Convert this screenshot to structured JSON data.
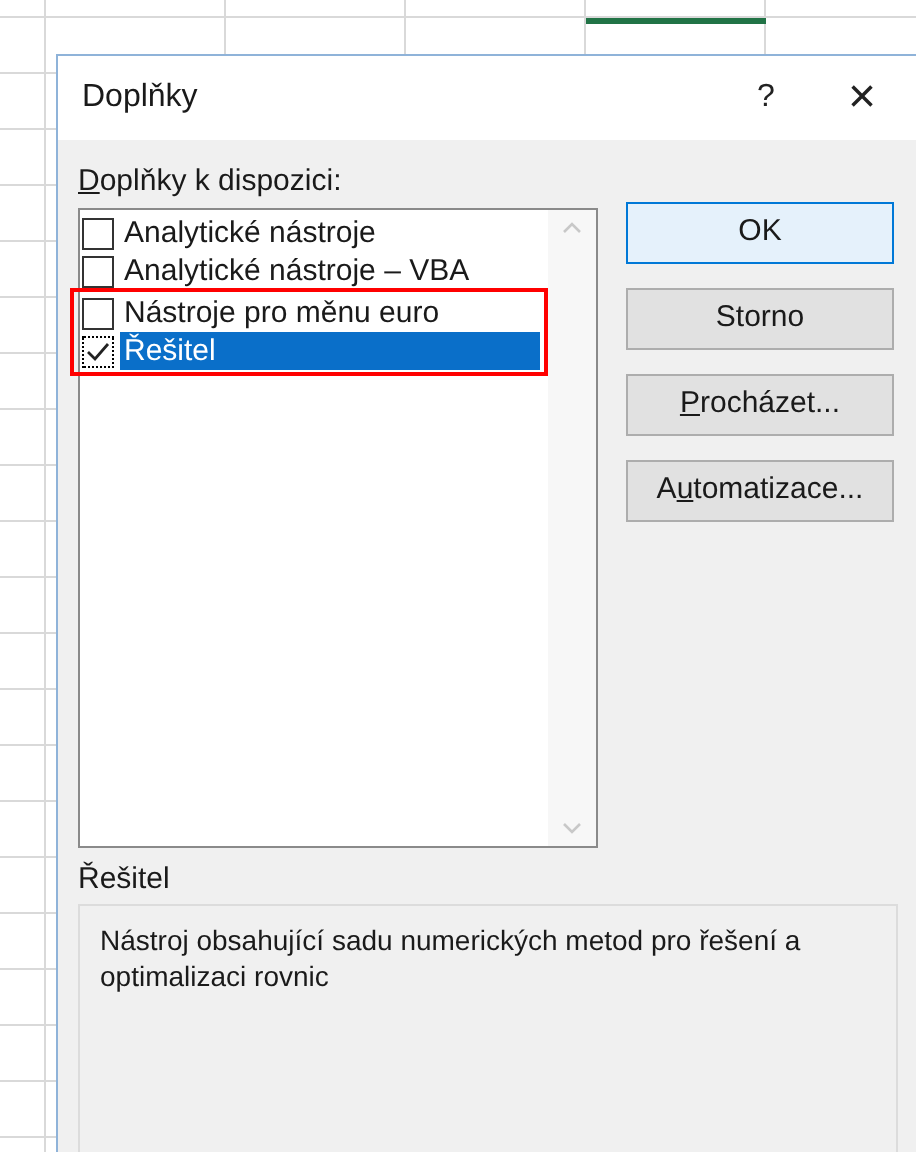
{
  "window": {
    "title": "Doplňky",
    "help": "?",
    "close": "×"
  },
  "list_label": {
    "key": "D",
    "after": "oplňky k dispozici:"
  },
  "addins": [
    {
      "label": "Analytické nástroje",
      "checked": false,
      "selected": false,
      "highlighted": false
    },
    {
      "label": "Analytické nástroje – VBA",
      "checked": false,
      "selected": false,
      "highlighted": false
    },
    {
      "label": "Nástroje pro měnu euro",
      "checked": false,
      "selected": false,
      "highlighted": true
    },
    {
      "label": "Řešitel",
      "checked": true,
      "selected": true,
      "highlighted": true
    }
  ],
  "buttons": [
    {
      "before": "OK",
      "default": true
    },
    {
      "before": "Storno",
      "default": false
    },
    {
      "key": "P",
      "after": "rocházet...",
      "default": false
    },
    {
      "before": "A",
      "key": "u",
      "after": "tomatizace...",
      "default": false
    }
  ],
  "description": {
    "title": "Řešitel",
    "text": "Nástroj obsahující sadu numerických metod pro řešení a optimalizaci rovnic"
  }
}
